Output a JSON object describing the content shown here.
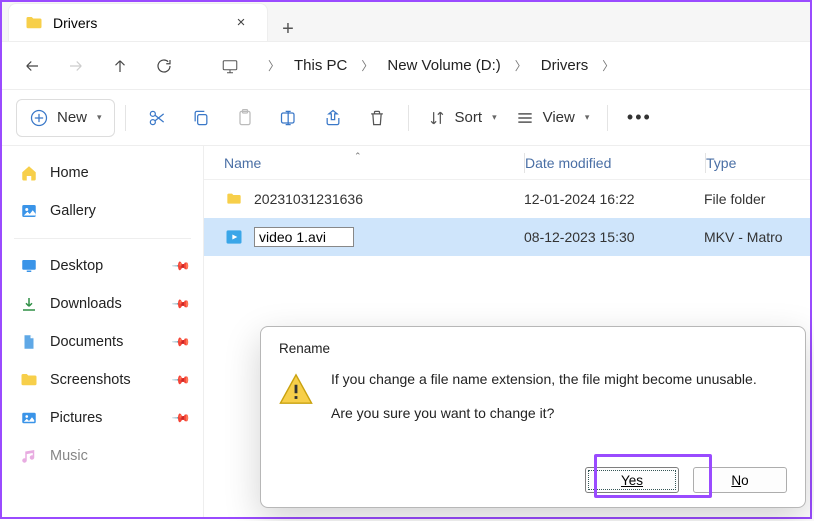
{
  "tab": {
    "title": "Drivers"
  },
  "breadcrumb": [
    "This PC",
    "New Volume (D:)",
    "Drivers"
  ],
  "toolbar": {
    "new": "New",
    "sort": "Sort",
    "view": "View"
  },
  "sidebar": {
    "quick": [
      {
        "label": "Home",
        "icon": "home"
      },
      {
        "label": "Gallery",
        "icon": "gallery"
      }
    ],
    "pinned": [
      {
        "label": "Desktop",
        "icon": "desktop"
      },
      {
        "label": "Downloads",
        "icon": "downloads"
      },
      {
        "label": "Documents",
        "icon": "documents"
      },
      {
        "label": "Screenshots",
        "icon": "folder"
      },
      {
        "label": "Pictures",
        "icon": "pictures"
      },
      {
        "label": "Music",
        "icon": "music"
      }
    ]
  },
  "columns": {
    "name": "Name",
    "date": "Date modified",
    "type": "Type"
  },
  "rows": [
    {
      "name": "20231031231636",
      "date": "12-01-2024 16:22",
      "type": "File folder",
      "kind": "folder"
    },
    {
      "name": "video 1.avi",
      "date": "08-12-2023 15:30",
      "type": "MKV - Matro",
      "kind": "video",
      "renaming": true
    }
  ],
  "dialog": {
    "title": "Rename",
    "line1": "If you change a file name extension, the file might become unusable.",
    "line2": "Are you sure you want to change it?",
    "yes": "Yes",
    "no": "No"
  }
}
